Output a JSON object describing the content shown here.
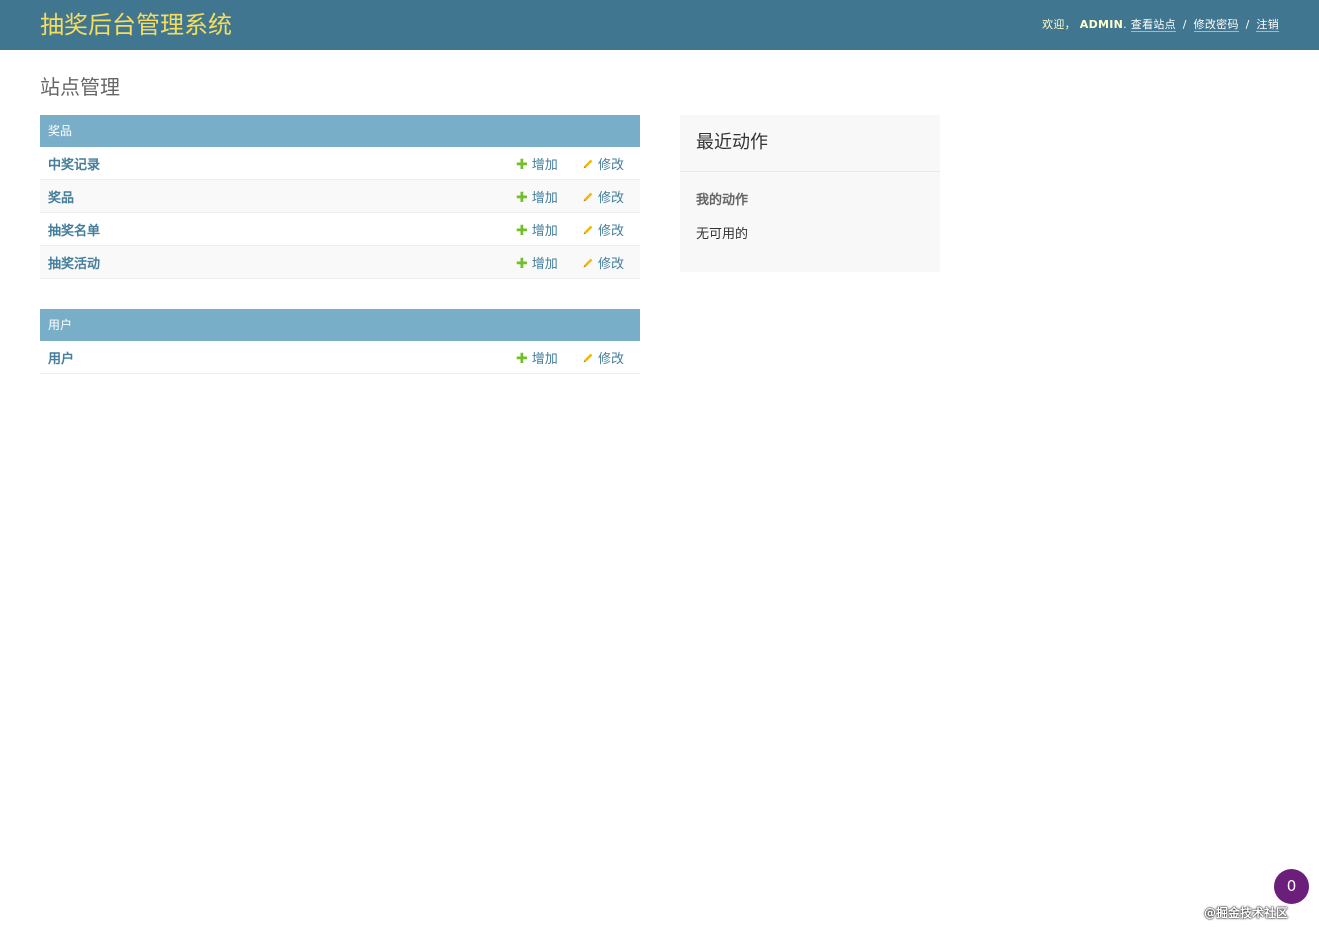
{
  "header": {
    "branding": "抽奖后台管理系统",
    "welcome": "欢迎，",
    "username": "ADMIN",
    "view_site": "查看站点",
    "change_password": "修改密码",
    "logout": "注销",
    "separator": "/",
    "colors": {
      "bar": "#417690",
      "branding": "#f5dd5d"
    }
  },
  "content": {
    "title": "站点管理"
  },
  "apps": [
    {
      "caption": "奖品",
      "models": [
        {
          "name": "中奖记录",
          "add": "增加",
          "change": "修改"
        },
        {
          "name": "奖品",
          "add": "增加",
          "change": "修改"
        },
        {
          "name": "抽奖名单",
          "add": "增加",
          "change": "修改"
        },
        {
          "name": "抽奖活动",
          "add": "增加",
          "change": "修改"
        }
      ]
    },
    {
      "caption": "用户",
      "models": [
        {
          "name": "用户",
          "add": "增加",
          "change": "修改"
        }
      ]
    }
  ],
  "recent_actions": {
    "title": "最近动作",
    "my_actions": "我的动作",
    "empty": "无可用的"
  },
  "badge": {
    "count": "0"
  },
  "watermark": "@掘金技术社区",
  "icons": {
    "add": "plus-icon",
    "change": "pencil-icon"
  }
}
